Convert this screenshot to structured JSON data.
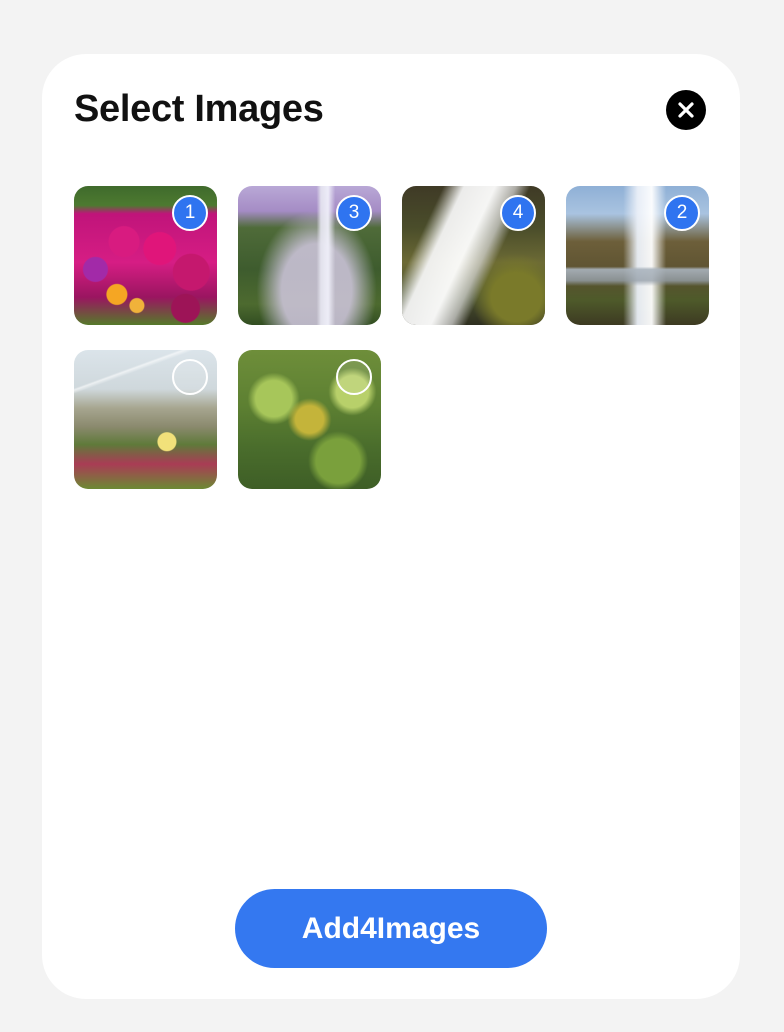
{
  "dialog": {
    "title": "Select Images",
    "close_icon": "close-icon",
    "add_button_label": "Add4Images"
  },
  "images": [
    {
      "name": "image-pink-flowers",
      "badge": "1",
      "selected": true
    },
    {
      "name": "image-misty-waterfall",
      "badge": "3",
      "selected": true
    },
    {
      "name": "image-white-waterfall",
      "badge": "4",
      "selected": true
    },
    {
      "name": "image-cliff-waterfall",
      "badge": "2",
      "selected": true
    },
    {
      "name": "image-coastal-plants",
      "badge": "",
      "selected": false
    },
    {
      "name": "image-green-leaves",
      "badge": "",
      "selected": false
    }
  ],
  "colors": {
    "accent": "#3478f0",
    "background": "#f3f3f3",
    "card": "#ffffff"
  }
}
